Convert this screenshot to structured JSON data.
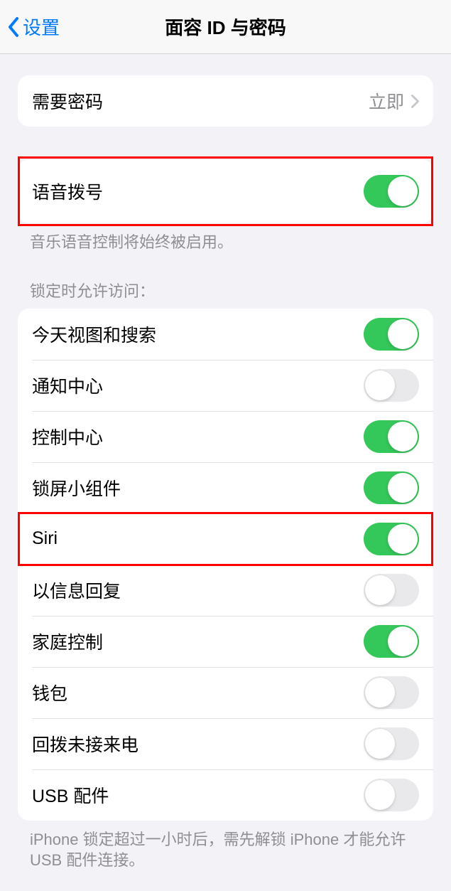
{
  "header": {
    "back_label": "设置",
    "title": "面容 ID 与密码"
  },
  "require_passcode": {
    "label": "需要密码",
    "value": "立即"
  },
  "voice_dial": {
    "label": "语音拨号",
    "footer": "音乐语音控制将始终被启用。"
  },
  "locked_access": {
    "header": "锁定时允许访问：",
    "items": [
      {
        "label": "今天视图和搜索",
        "on": true
      },
      {
        "label": "通知中心",
        "on": false
      },
      {
        "label": "控制中心",
        "on": true
      },
      {
        "label": "锁屏小组件",
        "on": true
      },
      {
        "label": "Siri",
        "on": true
      },
      {
        "label": "以信息回复",
        "on": false
      },
      {
        "label": "家庭控制",
        "on": true
      },
      {
        "label": "钱包",
        "on": false
      },
      {
        "label": "回拨未接来电",
        "on": false
      },
      {
        "label": "USB 配件",
        "on": false
      }
    ],
    "footer": "iPhone 锁定超过一小时后，需先解锁 iPhone 才能允许 USB 配件连接。"
  }
}
